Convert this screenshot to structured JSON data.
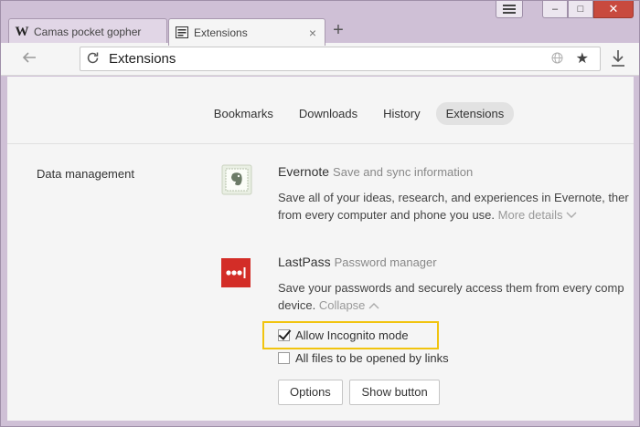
{
  "tabs": [
    {
      "title": "Camas pocket gopher",
      "favicon": "wikipedia-icon",
      "active": false
    },
    {
      "title": "Extensions",
      "favicon": "extensions-icon",
      "active": true,
      "close": "×"
    }
  ],
  "new_tab_label": "+",
  "window_controls": {
    "menu": "menu-icon",
    "minimize": "–",
    "restore": "□",
    "close": "✕"
  },
  "toolbar": {
    "url": "Extensions",
    "icons": [
      "back-icon",
      "reload-icon",
      "globe-icon",
      "star-icon",
      "download-icon"
    ]
  },
  "nav": {
    "items": [
      "Bookmarks",
      "Downloads",
      "History",
      "Extensions"
    ],
    "active": "Extensions"
  },
  "section": {
    "label": "Data management"
  },
  "extensions": [
    {
      "name": "Evernote",
      "subtitle": "Save and sync information",
      "desc_line1": "Save all of your ideas, research, and experiences in Evernote, ther",
      "desc_line2": "from every computer and phone you use.",
      "more_link": "More details"
    },
    {
      "name": "LastPass",
      "subtitle": "Password manager",
      "desc_line1": "Save your passwords and securely access them from every comp",
      "desc_line2": "device.",
      "more_link": "Collapse",
      "options": [
        {
          "label": "Allow Incognito mode",
          "checked": true
        },
        {
          "label": "All files to be opened by links",
          "checked": false
        }
      ],
      "buttons": [
        "Options",
        "Show button"
      ]
    }
  ],
  "colors": {
    "frame": "#cfc0d6",
    "highlight": "#f1c40f",
    "lastpass_red": "#d32d27",
    "close_button": "#c84a3e"
  }
}
